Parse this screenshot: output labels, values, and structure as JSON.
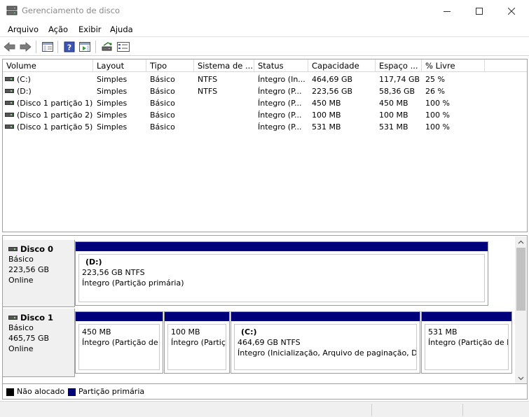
{
  "window": {
    "title": "Gerenciamento de disco",
    "minimize_glyph": "—",
    "maximize_glyph": "☐",
    "close_glyph": "✕"
  },
  "menu": {
    "items": [
      {
        "label": "Arquivo"
      },
      {
        "label": "Ação"
      },
      {
        "label": "Exibir"
      },
      {
        "label": "Ajuda"
      }
    ]
  },
  "toolbar": {
    "icons": [
      "back-arrow-icon",
      "forward-arrow-icon",
      "console-tree-icon",
      "help-icon",
      "show-action-pane-icon",
      "connect-disk-icon",
      "properties-list-icon"
    ]
  },
  "volume_list": {
    "columns": [
      "Volume",
      "Layout",
      "Tipo",
      "Sistema de ...",
      "Status",
      "Capacidade",
      "Espaço ...",
      "% Livre"
    ],
    "rows": [
      {
        "volume": "(C:)",
        "layout": "Simples",
        "tipo": "Básico",
        "fs": "NTFS",
        "status": "Íntegro (In...",
        "capacidade": "464,69 GB",
        "espaco": "117,74 GB",
        "livre": "25 %"
      },
      {
        "volume": "(D:)",
        "layout": "Simples",
        "tipo": "Básico",
        "fs": "NTFS",
        "status": "Íntegro (P...",
        "capacidade": "223,56 GB",
        "espaco": "58,36 GB",
        "livre": "26 %"
      },
      {
        "volume": "(Disco 1 partição 1)",
        "layout": "Simples",
        "tipo": "Básico",
        "fs": "",
        "status": "Íntegro (P...",
        "capacidade": "450 MB",
        "espaco": "450 MB",
        "livre": "100 %"
      },
      {
        "volume": "(Disco 1 partição 2)",
        "layout": "Simples",
        "tipo": "Básico",
        "fs": "",
        "status": "Íntegro (P...",
        "capacidade": "100 MB",
        "espaco": "100 MB",
        "livre": "100 %"
      },
      {
        "volume": "(Disco 1 partição 5)",
        "layout": "Simples",
        "tipo": "Básico",
        "fs": "",
        "status": "Íntegro (P...",
        "capacidade": "531 MB",
        "espaco": "531 MB",
        "livre": "100 %"
      }
    ]
  },
  "disks": [
    {
      "name": "Disco 0",
      "type": "Básico",
      "size": "223,56 GB",
      "state": "Online",
      "partitions": [
        {
          "label": "(D:)",
          "size": "223,56 GB NTFS",
          "status": "Íntegro (Partição primária)"
        }
      ]
    },
    {
      "name": "Disco 1",
      "type": "Básico",
      "size": "465,75 GB",
      "state": "Online",
      "partitions": [
        {
          "label": "",
          "size": "450 MB",
          "status": "Íntegro (Partição de Recuperação)"
        },
        {
          "label": "",
          "size": "100 MB",
          "status": "Íntegro (Partição de Sistema EFI)"
        },
        {
          "label": "(C:)",
          "size": "464,69 GB NTFS",
          "status": "Íntegro (Inicialização, Arquivo de paginação, Despejo de memória, Partição primária)"
        },
        {
          "label": "",
          "size": "531 MB",
          "status": "Íntegro (Partição de Recuperação)"
        }
      ]
    }
  ],
  "legend": {
    "items": [
      {
        "label": "Não alocado",
        "color": "#000000"
      },
      {
        "label": "Partição primária",
        "color": "#00007b"
      }
    ]
  },
  "colors": {
    "primary_partition": "#00007b",
    "unallocated": "#000000"
  },
  "scrollbar": {
    "up_glyph": "⌃",
    "down_glyph": "⌄"
  }
}
